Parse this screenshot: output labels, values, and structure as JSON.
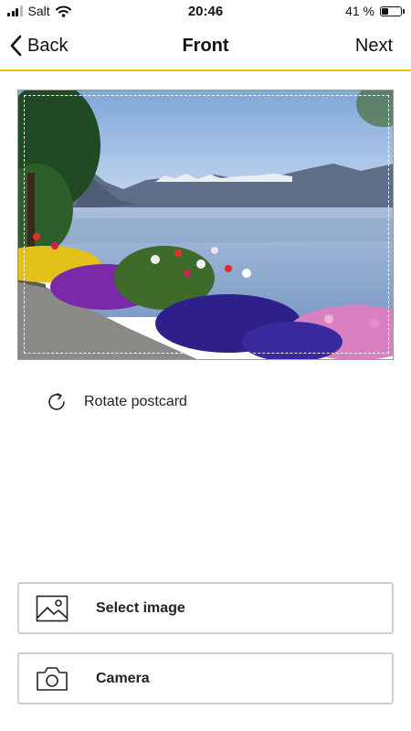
{
  "status_bar": {
    "carrier": "Salt",
    "time": "20:46",
    "battery_text": "41 %",
    "battery_level": 0.41
  },
  "nav": {
    "back_label": "Back",
    "title": "Front",
    "next_label": "Next"
  },
  "accent_color": "#f2c400",
  "rotate": {
    "label": "Rotate postcard",
    "icon": "rotate-icon"
  },
  "actions": [
    {
      "label": "Select image",
      "icon": "image-icon"
    },
    {
      "label": "Camera",
      "icon": "camera-icon"
    }
  ]
}
